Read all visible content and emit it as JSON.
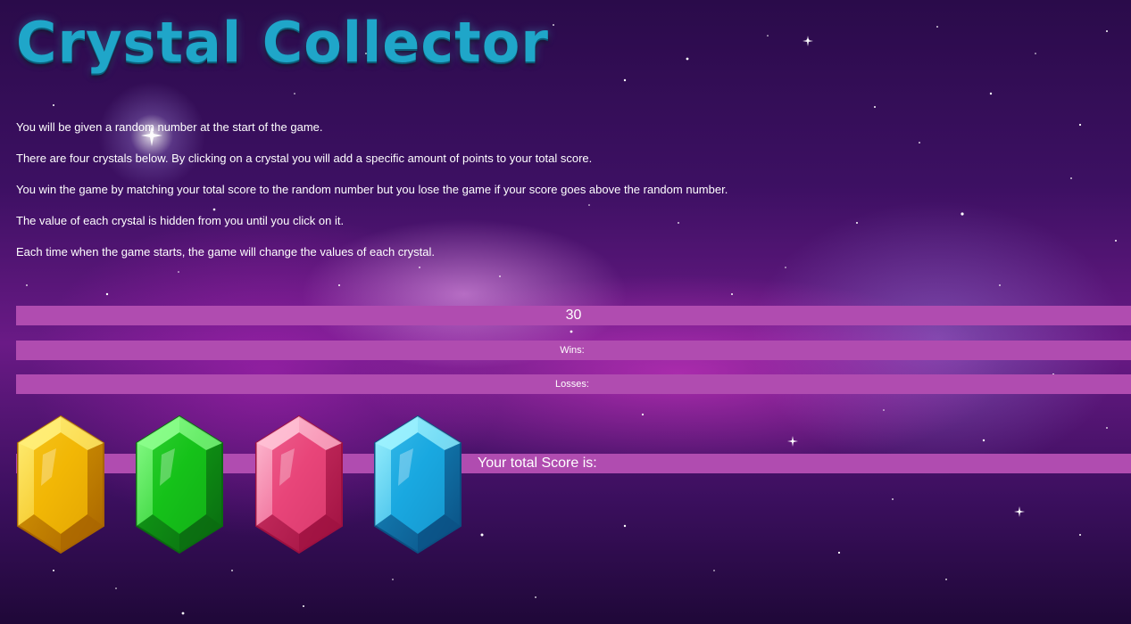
{
  "header": {
    "title": "Crystal Collector"
  },
  "instructions": [
    "You will be given a random number at the start of the game.",
    "There are four crystals below. By clicking on a crystal you will add a specific amount of points to your total score.",
    "You win the game by matching your total score to the random number but you lose the game if your score goes above the random number.",
    "The value of each crystal is hidden from you until you click on it.",
    "Each time when the game starts, the game will change the values of each crystal."
  ],
  "game": {
    "target_number": "30",
    "wins_label": "Wins:",
    "wins_value": "",
    "losses_label": "Losses:",
    "losses_value": "",
    "score_label": "Your total Score is:",
    "score_value": ""
  },
  "crystals": [
    {
      "name": "yellow-crystal",
      "color": "#f2b705",
      "dark": "#a86400",
      "light": "#fff07a"
    },
    {
      "name": "green-crystal",
      "color": "#16c21a",
      "dark": "#0a6a10",
      "light": "#8dff8d"
    },
    {
      "name": "red-crystal",
      "color": "#e8457a",
      "dark": "#9e1040",
      "light": "#ffc2d6"
    },
    {
      "name": "blue-crystal",
      "color": "#1aa8e0",
      "dark": "#0b4f82",
      "light": "#9ff3ff"
    }
  ],
  "colors": {
    "bar": "#b04cb0",
    "title": "#1fa6c9",
    "text": "#ffffff"
  }
}
